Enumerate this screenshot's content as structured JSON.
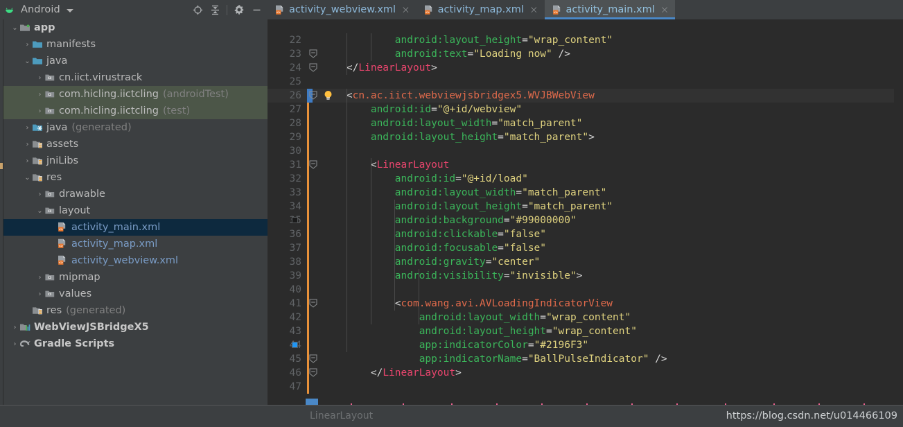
{
  "window": {
    "project_panel_title": "Android",
    "android_icon": "android-robot-icon",
    "caret_icon": "chevron-down-icon"
  },
  "toolbar": {
    "buttons": [
      {
        "name": "locate-in-tree-icon",
        "label": "Select Opened File"
      },
      {
        "name": "collapse-all-icon",
        "label": "Collapse All"
      },
      {
        "name": "settings-gear-icon",
        "label": "Settings"
      },
      {
        "name": "minimize-icon",
        "label": "Hide"
      }
    ]
  },
  "tree": {
    "items": [
      {
        "indent": 0,
        "arrow": "down",
        "icon": "module-folder-icon",
        "label": "app",
        "bold": true,
        "sub": "",
        "state": "none"
      },
      {
        "indent": 1,
        "arrow": "right",
        "icon": "folder-icon",
        "label": "manifests",
        "bold": false,
        "sub": "",
        "state": "none"
      },
      {
        "indent": 1,
        "arrow": "down",
        "icon": "folder-icon",
        "label": "java",
        "bold": false,
        "sub": "",
        "state": "none"
      },
      {
        "indent": 2,
        "arrow": "right",
        "icon": "package-icon",
        "label": "cn.iict.virustrack",
        "bold": false,
        "sub": "",
        "state": "none"
      },
      {
        "indent": 2,
        "arrow": "right",
        "icon": "package-icon",
        "label": "com.hicling.iictcling",
        "bold": false,
        "sub": "(androidTest)",
        "state": "green"
      },
      {
        "indent": 2,
        "arrow": "right",
        "icon": "package-icon",
        "label": "com.hicling.iictcling",
        "bold": false,
        "sub": "(test)",
        "state": "green"
      },
      {
        "indent": 1,
        "arrow": "right",
        "icon": "generated-folder-icon",
        "label": "java",
        "bold": false,
        "sub": "(generated)",
        "state": "none"
      },
      {
        "indent": 1,
        "arrow": "right",
        "icon": "res-folder-icon",
        "label": "assets",
        "bold": false,
        "sub": "",
        "state": "none"
      },
      {
        "indent": 1,
        "arrow": "right",
        "icon": "res-folder-icon",
        "label": "jniLibs",
        "bold": false,
        "sub": "",
        "state": "none"
      },
      {
        "indent": 1,
        "arrow": "down",
        "icon": "res-folder-icon",
        "label": "res",
        "bold": false,
        "sub": "",
        "state": "none"
      },
      {
        "indent": 2,
        "arrow": "right",
        "icon": "package-icon",
        "label": "drawable",
        "bold": false,
        "sub": "",
        "state": "none"
      },
      {
        "indent": 2,
        "arrow": "down",
        "icon": "package-icon",
        "label": "layout",
        "bold": false,
        "sub": "",
        "state": "none"
      },
      {
        "indent": 3,
        "arrow": "none",
        "icon": "xml-layout-icon",
        "label": "activity_main.xml",
        "bold": false,
        "sub": "",
        "state": "blue"
      },
      {
        "indent": 3,
        "arrow": "none",
        "icon": "xml-layout-icon",
        "label": "activity_map.xml",
        "bold": false,
        "sub": "",
        "state": "none"
      },
      {
        "indent": 3,
        "arrow": "none",
        "icon": "xml-layout-icon",
        "label": "activity_webview.xml",
        "bold": false,
        "sub": "",
        "state": "none"
      },
      {
        "indent": 2,
        "arrow": "right",
        "icon": "package-icon",
        "label": "mipmap",
        "bold": false,
        "sub": "",
        "state": "none"
      },
      {
        "indent": 2,
        "arrow": "right",
        "icon": "package-icon",
        "label": "values",
        "bold": false,
        "sub": "",
        "state": "none"
      },
      {
        "indent": 1,
        "arrow": "none",
        "icon": "res-folder-icon",
        "label": "res",
        "bold": false,
        "sub": "(generated)",
        "state": "none"
      },
      {
        "indent": 0,
        "arrow": "right",
        "icon": "library-module-icon",
        "label": "WebViewJSBridgeX5",
        "bold": true,
        "sub": "",
        "state": "none"
      },
      {
        "indent": 0,
        "arrow": "right",
        "icon": "gradle-elephant-icon",
        "label": "Gradle Scripts",
        "bold": true,
        "sub": "",
        "state": "none"
      }
    ]
  },
  "tabs": [
    {
      "label": "activity_webview.xml",
      "icon": "xml-layout-icon",
      "close": "×",
      "active": false
    },
    {
      "label": "activity_map.xml",
      "icon": "xml-layout-icon",
      "close": "×",
      "active": false
    },
    {
      "label": "activity_main.xml",
      "icon": "xml-layout-icon",
      "close": "×",
      "active": true
    }
  ],
  "editor": {
    "first_line": 22,
    "caret_line": 26,
    "lines": [
      {
        "n": 22,
        "indent": 0,
        "text": "            android:layout_height=\"wrap_content\""
      },
      {
        "n": 23,
        "indent": 0,
        "text": "            android:text=\"Loading now\" />"
      },
      {
        "n": 24,
        "indent": 0,
        "text": "    </LinearLayout>"
      },
      {
        "n": 25,
        "indent": 0,
        "text": ""
      },
      {
        "n": 26,
        "indent": 0,
        "text": "    <cn.ac.iict.webviewjsbridgex5.WVJBWebView"
      },
      {
        "n": 27,
        "indent": 0,
        "text": "        android:id=\"@+id/webview\""
      },
      {
        "n": 28,
        "indent": 0,
        "text": "        android:layout_width=\"match_parent\""
      },
      {
        "n": 29,
        "indent": 0,
        "text": "        android:layout_height=\"match_parent\">"
      },
      {
        "n": 30,
        "indent": 0,
        "text": ""
      },
      {
        "n": 31,
        "indent": 0,
        "text": "        <LinearLayout"
      },
      {
        "n": 32,
        "indent": 0,
        "text": "            android:id=\"@+id/load\""
      },
      {
        "n": 33,
        "indent": 0,
        "text": "            android:layout_width=\"match_parent\""
      },
      {
        "n": 34,
        "indent": 0,
        "text": "            android:layout_height=\"match_parent\""
      },
      {
        "n": 35,
        "indent": 0,
        "text": "            android:background=\"#99000000\""
      },
      {
        "n": 36,
        "indent": 0,
        "text": "            android:clickable=\"false\""
      },
      {
        "n": 37,
        "indent": 0,
        "text": "            android:focusable=\"false\""
      },
      {
        "n": 38,
        "indent": 0,
        "text": "            android:gravity=\"center\""
      },
      {
        "n": 39,
        "indent": 0,
        "text": "            android:visibility=\"invisible\">"
      },
      {
        "n": 40,
        "indent": 0,
        "text": ""
      },
      {
        "n": 41,
        "indent": 0,
        "text": "            <com.wang.avi.AVLoadingIndicatorView"
      },
      {
        "n": 42,
        "indent": 0,
        "text": "                android:layout_width=\"wrap_content\""
      },
      {
        "n": 43,
        "indent": 0,
        "text": "                android:layout_height=\"wrap_content\""
      },
      {
        "n": 44,
        "indent": 0,
        "text": "                app:indicatorColor=\"#2196F3\""
      },
      {
        "n": 45,
        "indent": 0,
        "text": "                app:indicatorName=\"BallPulseIndicator\" />"
      },
      {
        "n": 46,
        "indent": 0,
        "text": "        </LinearLayout>"
      },
      {
        "n": 47,
        "indent": 0,
        "text": ""
      }
    ],
    "gutter_markers": [
      {
        "line": 35,
        "type": "color-swatch",
        "color": "#1a1a1a"
      },
      {
        "line": 44,
        "type": "color-swatch",
        "color": "#2196F3"
      }
    ],
    "intention_bulb": {
      "line": 26,
      "icon": "lightbulb-icon"
    },
    "fold_markers": [
      23,
      24,
      26,
      31,
      41,
      45,
      46
    ],
    "highlight_line": 23,
    "highlight_text": "android:text=\"Loading now\"",
    "colors": {
      "background": "#2b2b2b",
      "tag": "#e8456d",
      "attribute": "#3bb55a",
      "value": "#dfd27f",
      "namespace_tag": "#e06a4b",
      "line_number": "#606366",
      "change_bar": "#e8913a",
      "caret_marker": "#3f7cc4",
      "search_highlight": "#4f4b2d"
    }
  },
  "status": {
    "breadcrumb": "LinearLayout",
    "watermark": "https://blog.csdn.net/u014466109"
  }
}
